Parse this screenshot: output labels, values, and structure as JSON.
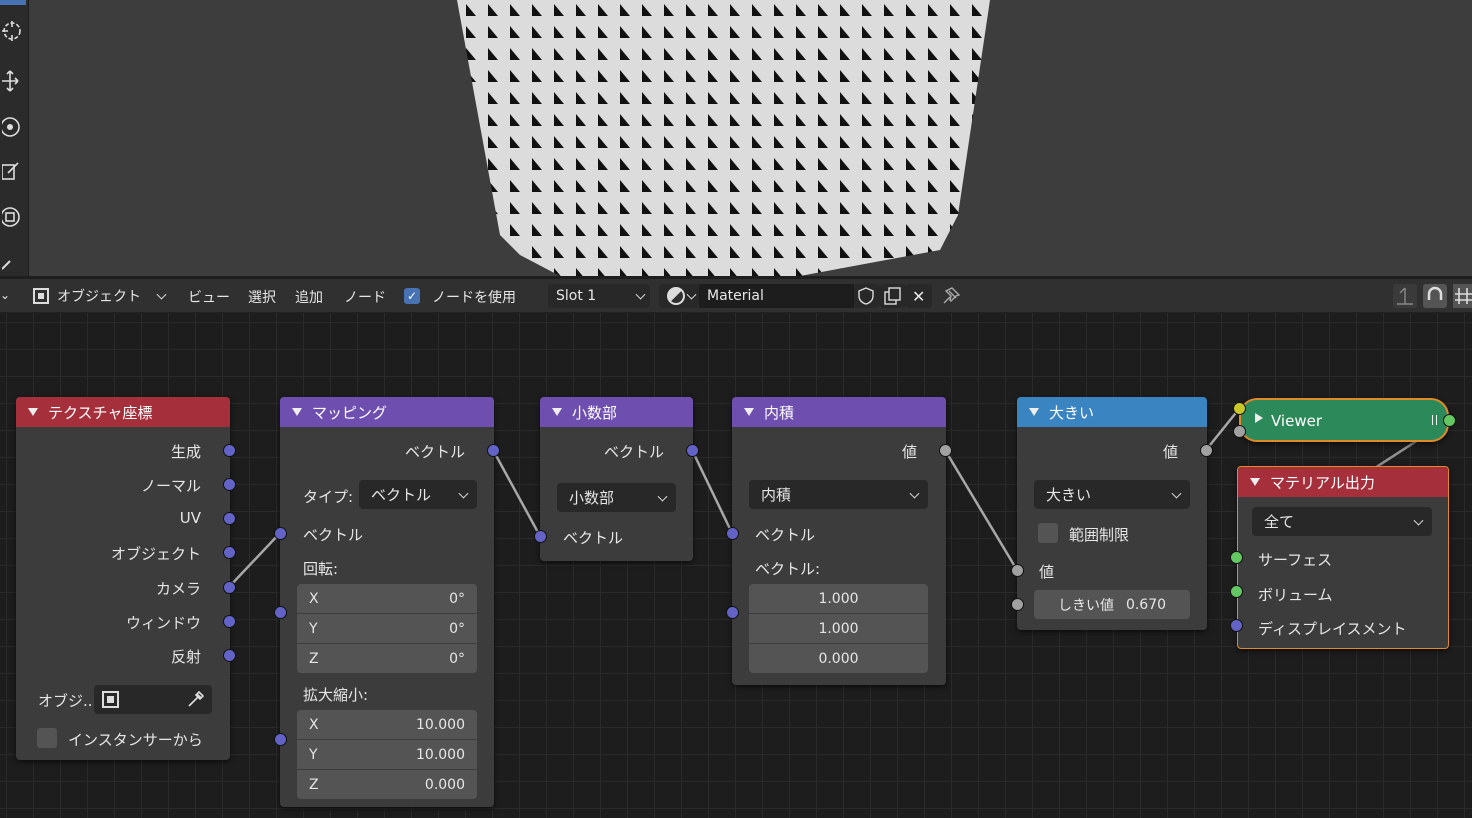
{
  "header": {
    "mode": "オブジェクト",
    "menus": [
      "ビュー",
      "選択",
      "追加",
      "ノード"
    ],
    "use_nodes": "ノードを使用",
    "slot": "Slot 1",
    "material": "Material"
  },
  "nodes": {
    "texcoord": {
      "title": "テクスチャ座標",
      "outputs": [
        "生成",
        "ノーマル",
        "UV",
        "オブジェクト",
        "カメラ",
        "ウィンドウ",
        "反射"
      ],
      "object_label": "オブジ...",
      "instancer": "インスタンサーから"
    },
    "mapping": {
      "title": "マッピング",
      "output": "ベクトル",
      "type_label": "タイプ:",
      "type_value": "ベクトル",
      "input": "ベクトル",
      "rotation_label": "回転:",
      "rotation": [
        {
          "axis": "X",
          "value": "0°"
        },
        {
          "axis": "Y",
          "value": "0°"
        },
        {
          "axis": "Z",
          "value": "0°"
        }
      ],
      "scale_label": "拡大縮小:",
      "scale": [
        {
          "axis": "X",
          "value": "10.000"
        },
        {
          "axis": "Y",
          "value": "10.000"
        },
        {
          "axis": "Z",
          "value": "0.000"
        }
      ]
    },
    "fraction": {
      "title": "小数部",
      "output": "ベクトル",
      "op": "小数部",
      "input": "ベクトル"
    },
    "dot": {
      "title": "内積",
      "output": "値",
      "op": "内積",
      "input": "ベクトル",
      "vec_label": "ベクトル:",
      "values": [
        "1.000",
        "1.000",
        "0.000"
      ]
    },
    "greater": {
      "title": "大きい",
      "output": "値",
      "op": "大きい",
      "clamp": "範囲制限",
      "input": "値",
      "threshold_label": "しきい値",
      "threshold": "0.670"
    },
    "viewer": {
      "title": "Viewer"
    },
    "matout": {
      "title": "マテリアル出力",
      "target": "全て",
      "inputs": [
        "サーフェス",
        "ボリューム",
        "ディスプレイスメント"
      ]
    }
  },
  "colors": {
    "texcoord": "#a5303c",
    "mapping": "#6e4fb0",
    "math": "#6e4fb0",
    "greater": "#3a84c2",
    "viewer": "#2c8a5a",
    "output": "#a5303c"
  }
}
